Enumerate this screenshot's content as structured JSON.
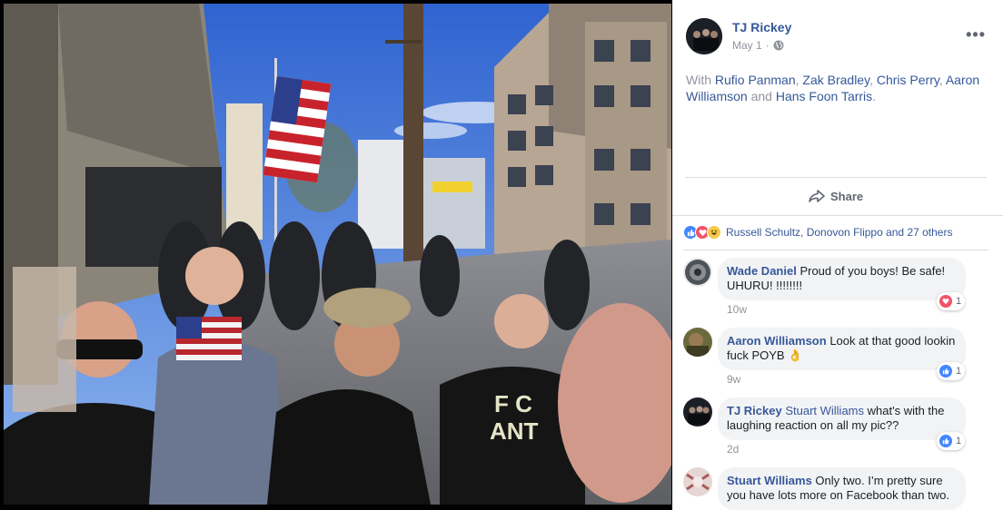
{
  "post": {
    "author": "TJ Rickey",
    "date": "May 1",
    "separator": "·",
    "audience_icon": "globe-icon",
    "more_icon": "more-options-icon",
    "with_text": {
      "prefix": "With",
      "people": [
        "Rufio Panman",
        "Zak Bradley",
        "Chris Perry",
        "Aaron Williamson",
        "Hans Foon Tarris"
      ],
      "comma": ",",
      "and": "and",
      "end": "."
    },
    "share_label": "Share"
  },
  "reactions": {
    "icons": [
      "like-reaction-icon",
      "love-reaction-icon",
      "haha-reaction-icon"
    ],
    "summary": "Russell Schultz, Donovon Flippo and 27 others"
  },
  "comments": [
    {
      "name": "Wade Daniel",
      "tag": "",
      "text": "Proud of you boys! Be safe! UHURU! !!!!!!!!",
      "time": "10w",
      "reaction": "love",
      "count": "1"
    },
    {
      "name": "Aaron Williamson",
      "tag": "",
      "text": "Look at that good lookin fuck POYB",
      "emoji": "👌",
      "time": "9w",
      "reaction": "like",
      "count": "1"
    },
    {
      "name": "TJ Rickey",
      "tag": "Stuart Williams",
      "text": "what's with the laughing reaction on all my pic??",
      "time": "2d",
      "reaction": "like",
      "count": "1"
    },
    {
      "name": "Stuart Williams",
      "tag": "",
      "text": "Only two. I’m pretty sure you have lots more on Facebook than two.",
      "time": "",
      "reaction": "",
      "count": ""
    }
  ],
  "colors": {
    "link": "#365899",
    "meta": "#90949c",
    "like": "#4287ff",
    "love": "#f25268",
    "haha": "#f7c94b"
  }
}
